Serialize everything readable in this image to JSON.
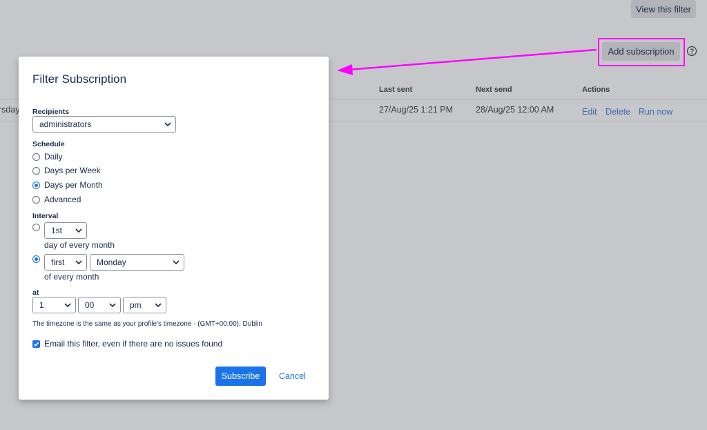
{
  "header": {
    "view_filter_label": "View this filter",
    "add_subscription_label": "Add subscription",
    "help_icon": "question-circle-icon"
  },
  "table": {
    "columns": [
      "Last sent",
      "Next send",
      "Actions"
    ],
    "row": {
      "truncated_text": "rsday",
      "last_sent": "27/Aug/25 1:21 PM",
      "next_send": "28/Aug/25 12:00 AM",
      "actions": [
        "Edit",
        "Delete",
        "Run now"
      ]
    }
  },
  "annotation": {
    "color": "#ff00ff"
  },
  "dialog": {
    "title": "Filter Subscription",
    "recipients_label": "Recipients",
    "recipients_value": "administrators",
    "schedule_label": "Schedule",
    "schedule_options": [
      "Daily",
      "Days per Week",
      "Days per Month",
      "Advanced"
    ],
    "schedule_selected": "Days per Month",
    "interval_label": "Interval",
    "interval_option1": {
      "day": "1st",
      "suffix": "day of every month",
      "selected": false
    },
    "interval_option2": {
      "ordinal": "first",
      "weekday": "Monday",
      "suffix": "of every month",
      "selected": true
    },
    "at_label": "at",
    "time": {
      "hour": "1",
      "minute": "00",
      "meridiem": "pm"
    },
    "timezone_note": "The timezone is the same as your profile's timezone - (GMT+00:00), Dublin",
    "email_checkbox_label": "Email this filter, even if there are no issues found",
    "email_checked": true,
    "subscribe_label": "Subscribe",
    "cancel_label": "Cancel"
  },
  "colors": {
    "primary": "#1a73e8",
    "overlay_bg": "#c6c7cb"
  }
}
